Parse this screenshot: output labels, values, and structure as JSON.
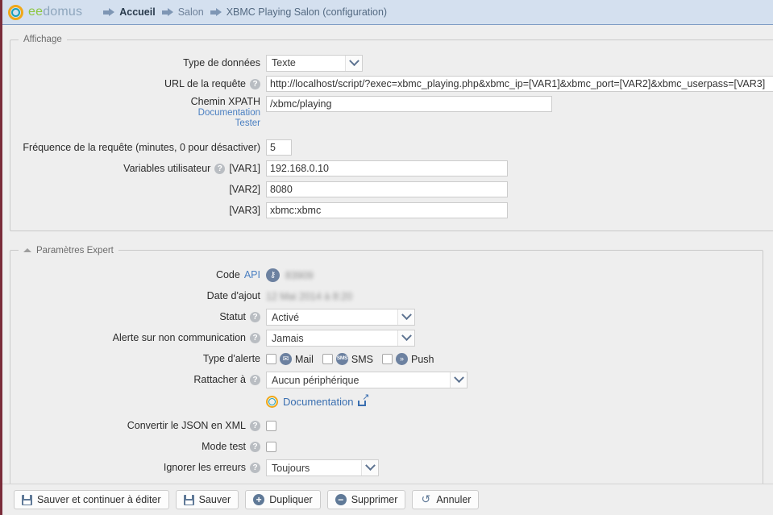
{
  "header": {
    "logo_ee": "ee",
    "logo_domus": "domus",
    "breadcrumb": [
      {
        "label": "Accueil"
      },
      {
        "label": "Salon"
      },
      {
        "label": "XBMC Playing Salon (configuration)"
      }
    ]
  },
  "display_section": {
    "legend": "Affichage",
    "data_type": {
      "label": "Type de données",
      "value": "Texte"
    },
    "url": {
      "label": "URL de la requête",
      "value": "http://localhost/script/?exec=xbmc_playing.php&xbmc_ip=[VAR1]&xbmc_port=[VAR2]&xbmc_userpass=[VAR3]"
    },
    "xpath": {
      "label": "Chemin XPATH",
      "value": "/xbmc/playing",
      "doc_link": "Documentation",
      "test_link": "Tester"
    },
    "frequency": {
      "label": "Fréquence de la requête (minutes, 0 pour désactiver)",
      "value": "5"
    },
    "user_variables": {
      "label": "Variables utilisateur",
      "rows": [
        {
          "key": "[VAR1]",
          "value": "192.168.0.10"
        },
        {
          "key": "[VAR2]",
          "value": "8080"
        },
        {
          "key": "[VAR3]",
          "value": "xbmc:xbmc"
        }
      ]
    }
  },
  "expert_section": {
    "legend": "Paramètres Expert",
    "api_code": {
      "label": "Code",
      "link": "API",
      "value": "83909"
    },
    "date_added": {
      "label": "Date d'ajout",
      "value": "12 Mai 2014 à 8:20"
    },
    "status": {
      "label": "Statut",
      "value": "Activé"
    },
    "no_comm_alert": {
      "label": "Alerte sur non communication",
      "value": "Jamais"
    },
    "alert_type": {
      "label": "Type d'alerte",
      "options": [
        {
          "name": "Mail",
          "icon": "mail-icon",
          "checked": false
        },
        {
          "name": "SMS",
          "icon": "sms-icon",
          "checked": false
        },
        {
          "name": "Push",
          "icon": "push-icon",
          "checked": false
        }
      ]
    },
    "attach_to": {
      "label": "Rattacher à",
      "value": "Aucun périphérique"
    },
    "documentation": {
      "label": "Documentation"
    },
    "json_to_xml": {
      "label": "Convertir le JSON en XML",
      "checked": false
    },
    "test_mode": {
      "label": "Mode test",
      "checked": false
    },
    "ignore_errors": {
      "label": "Ignorer les erreurs",
      "value": "Toujours"
    }
  },
  "footer": {
    "buttons": [
      {
        "label": "Sauver et continuer à éditer",
        "icon": "floppy-icon"
      },
      {
        "label": "Sauver",
        "icon": "floppy-icon"
      },
      {
        "label": "Dupliquer",
        "icon": "plus-circle-icon"
      },
      {
        "label": "Supprimer",
        "icon": "minus-circle-icon"
      },
      {
        "label": "Annuler",
        "icon": "undo-icon"
      }
    ]
  },
  "colors": {
    "header_bg": "#d4e0ef",
    "page_bg": "#eeeeee",
    "link": "#3a6fb0",
    "logo_green": "#8cc63f",
    "logo_orange": "#f0a818",
    "logo_teal": "#1aa0b8",
    "left_stripe": "#7a2c3a"
  }
}
